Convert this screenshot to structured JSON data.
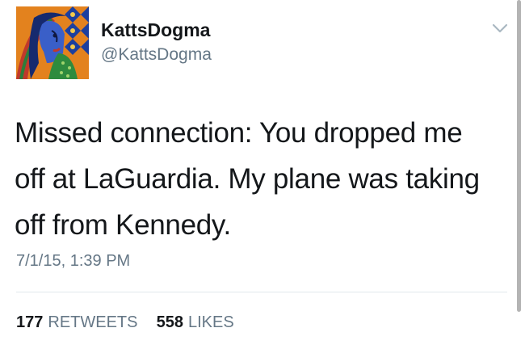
{
  "user": {
    "display_name": "KattsDogma",
    "handle": "@KattsDogma",
    "avatar_icon": "abstract-portrait-avatar"
  },
  "menu": {
    "icon": "chevron-down-icon"
  },
  "tweet": {
    "text_lines": [
      "Missed connection: You dropped me",
      "off at LaGuardia. My plane was taking",
      "off from Kennedy."
    ],
    "timestamp": "7/1/15, 1:39 PM"
  },
  "stats": {
    "retweets_count": "177",
    "retweets_label": "RETWEETS",
    "likes_count": "558",
    "likes_label": "LIKES"
  },
  "colors": {
    "primary_text": "#14171a",
    "secondary_text": "#657786",
    "divider": "#e1e8ed"
  }
}
